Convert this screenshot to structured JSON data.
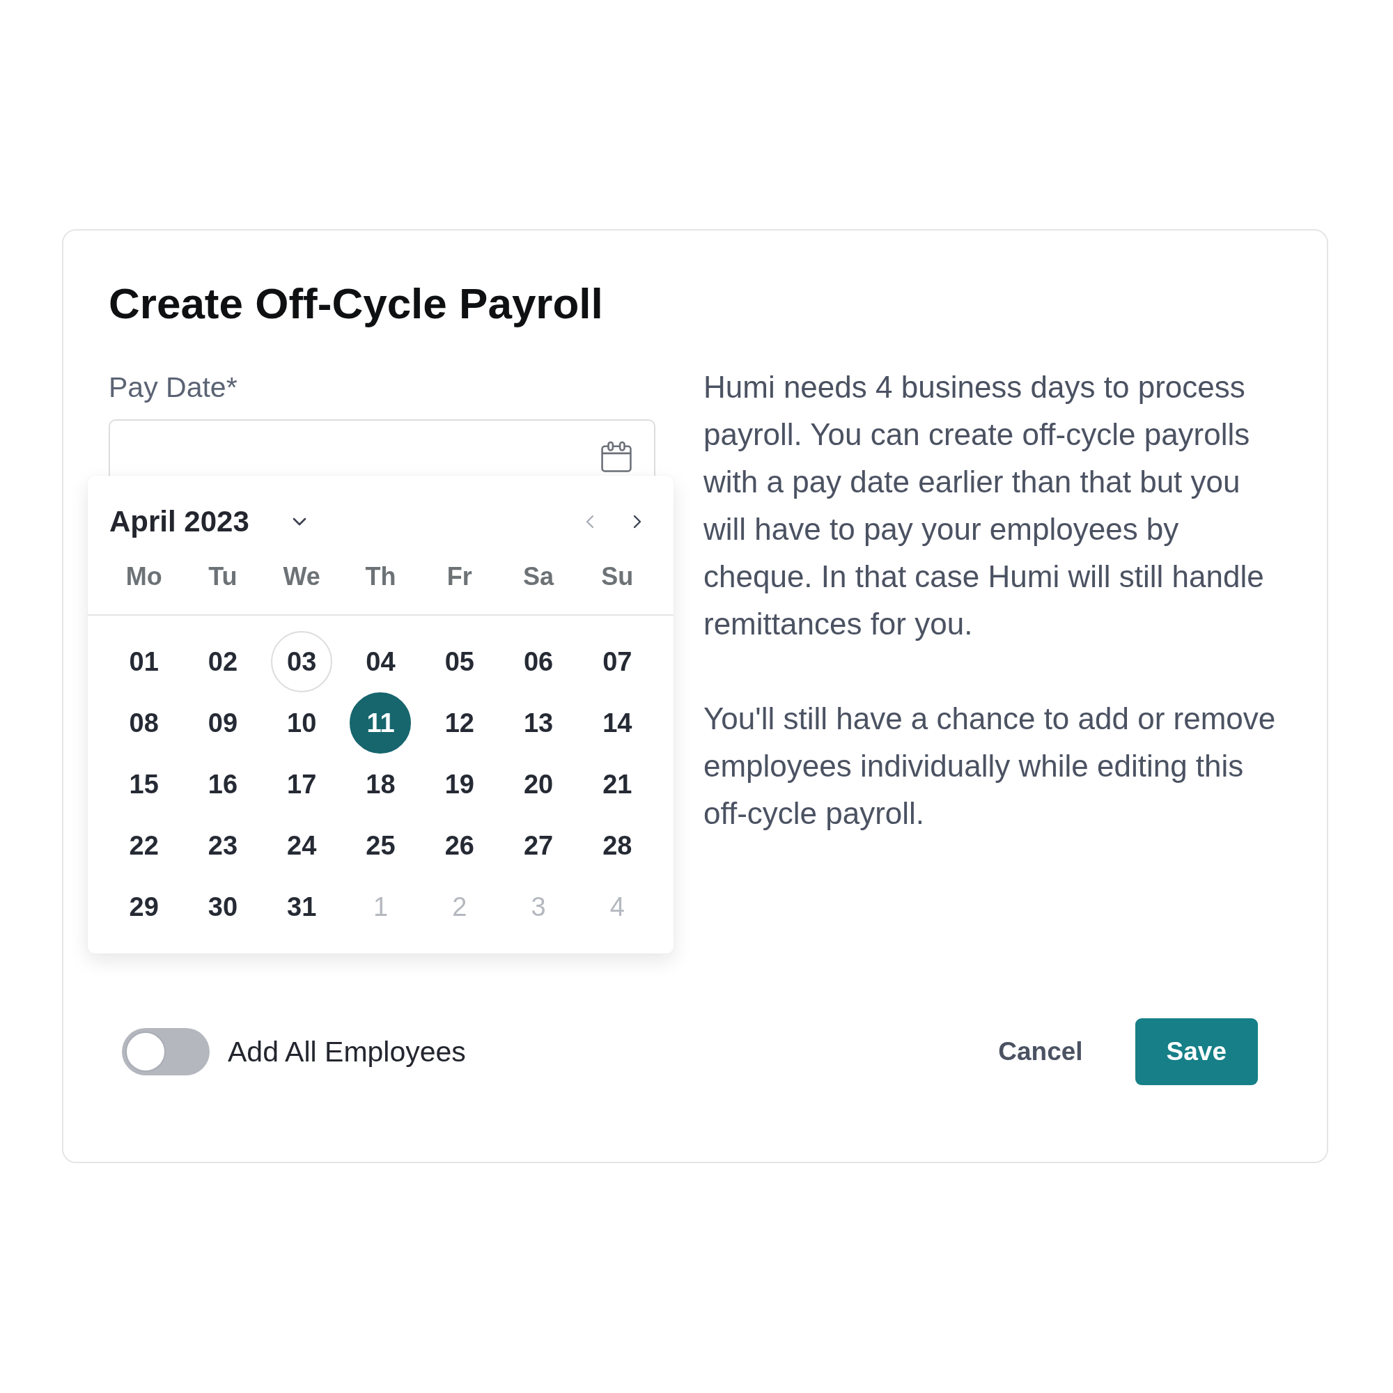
{
  "dialog": {
    "title": "Create Off-Cycle Payroll"
  },
  "pay_date": {
    "label": "Pay Date*"
  },
  "calendar": {
    "month": "April 2023",
    "nav": [
      {
        "kind": "prev",
        "disabled": true
      },
      {
        "kind": "next",
        "disabled": false
      }
    ],
    "weekdays": [
      "Mo",
      "Tu",
      "We",
      "Th",
      "Fr",
      "Sa",
      "Su"
    ],
    "days": [
      {
        "label": "01",
        "selected": false,
        "today": false,
        "muted": false
      },
      {
        "label": "02",
        "selected": false,
        "today": false,
        "muted": false
      },
      {
        "label": "03",
        "selected": false,
        "today": true,
        "muted": false
      },
      {
        "label": "04",
        "selected": false,
        "today": false,
        "muted": false
      },
      {
        "label": "05",
        "selected": false,
        "today": false,
        "muted": false
      },
      {
        "label": "06",
        "selected": false,
        "today": false,
        "muted": false
      },
      {
        "label": "07",
        "selected": false,
        "today": false,
        "muted": false
      },
      {
        "label": "08",
        "selected": false,
        "today": false,
        "muted": false
      },
      {
        "label": "09",
        "selected": false,
        "today": false,
        "muted": false
      },
      {
        "label": "10",
        "selected": false,
        "today": false,
        "muted": false
      },
      {
        "label": "11",
        "selected": true,
        "today": false,
        "muted": false
      },
      {
        "label": "12",
        "selected": false,
        "today": false,
        "muted": false
      },
      {
        "label": "13",
        "selected": false,
        "today": false,
        "muted": false
      },
      {
        "label": "14",
        "selected": false,
        "today": false,
        "muted": false
      },
      {
        "label": "15",
        "selected": false,
        "today": false,
        "muted": false
      },
      {
        "label": "16",
        "selected": false,
        "today": false,
        "muted": false
      },
      {
        "label": "17",
        "selected": false,
        "today": false,
        "muted": false
      },
      {
        "label": "18",
        "selected": false,
        "today": false,
        "muted": false
      },
      {
        "label": "19",
        "selected": false,
        "today": false,
        "muted": false
      },
      {
        "label": "20",
        "selected": false,
        "today": false,
        "muted": false
      },
      {
        "label": "21",
        "selected": false,
        "today": false,
        "muted": false
      },
      {
        "label": "22",
        "selected": false,
        "today": false,
        "muted": false
      },
      {
        "label": "23",
        "selected": false,
        "today": false,
        "muted": false
      },
      {
        "label": "24",
        "selected": false,
        "today": false,
        "muted": false
      },
      {
        "label": "25",
        "selected": false,
        "today": false,
        "muted": false
      },
      {
        "label": "26",
        "selected": false,
        "today": false,
        "muted": false
      },
      {
        "label": "27",
        "selected": false,
        "today": false,
        "muted": false
      },
      {
        "label": "28",
        "selected": false,
        "today": false,
        "muted": false
      },
      {
        "label": "29",
        "selected": false,
        "today": false,
        "muted": false
      },
      {
        "label": "30",
        "selected": false,
        "today": false,
        "muted": false
      },
      {
        "label": "31",
        "selected": false,
        "today": false,
        "muted": false
      },
      {
        "label": "1",
        "selected": false,
        "today": false,
        "muted": true
      },
      {
        "label": "2",
        "selected": false,
        "today": false,
        "muted": true
      },
      {
        "label": "3",
        "selected": false,
        "today": false,
        "muted": true
      },
      {
        "label": "4",
        "selected": false,
        "today": false,
        "muted": true
      }
    ]
  },
  "description": [
    "Humi needs 4 business days to process payroll. You can create off-cycle payrolls with a pay date earlier than that but you will have to pay your employees by cheque. In that case Humi will still handle remittances for you.",
    "You'll still have a chance to add or remove employees individually while editing this off-cycle payroll."
  ],
  "toggle": {
    "label": "Add All Employees",
    "on": false
  },
  "buttons": [
    {
      "label": "Cancel",
      "kind": "text"
    },
    {
      "label": "Save",
      "kind": "primary"
    }
  ]
}
